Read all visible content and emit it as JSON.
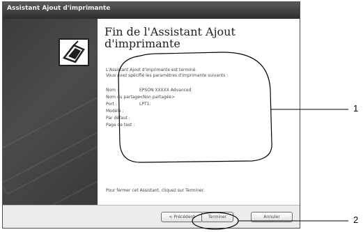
{
  "window": {
    "title": "Assistant Ajout d'imprimante"
  },
  "content": {
    "heading": "Fin de l'Assistant Ajout d'imprimante",
    "intro_lines": [
      "L'Assistant Ajout d'imprimante est terminé.",
      "Vous avez spécifié les paramètres d'imprimante suivants :"
    ],
    "params": [
      {
        "label": "Nom :",
        "value": "EPSON XXXXX Advanced"
      },
      {
        "label": "Nom du partage :",
        "value": "<Non partagée>"
      },
      {
        "label": "Port :",
        "value": "LPT1:"
      },
      {
        "label": "Modèle :",
        "value": ""
      },
      {
        "label": "Par défaut :",
        "value": ""
      },
      {
        "label": "Page de test :",
        "value": ""
      }
    ],
    "footer_text": "Pour fermer cet Assistant, cliquez sur Terminer."
  },
  "buttons": {
    "back": "< Précédent",
    "finish": "Terminer",
    "cancel": "Annuler"
  },
  "callouts": {
    "one": "1",
    "two": "2"
  },
  "icons": {
    "wizard": "printer-icon"
  }
}
